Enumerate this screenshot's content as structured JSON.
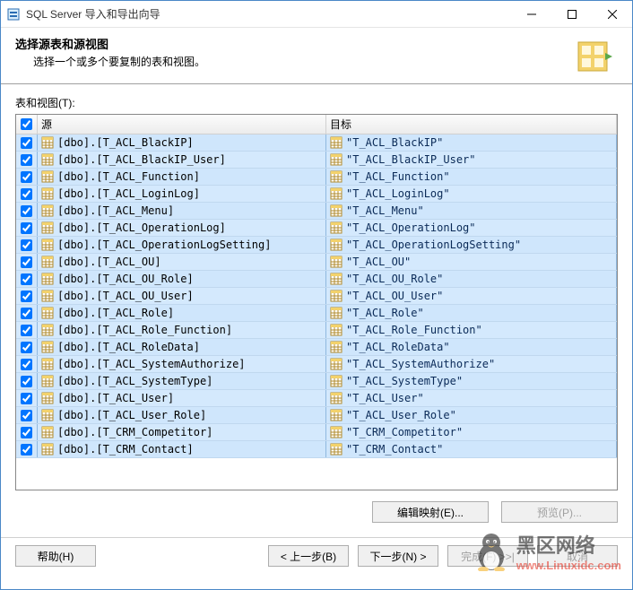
{
  "window": {
    "title": "SQL Server 导入和导出向导",
    "header_title": "选择源表和源视图",
    "header_sub": "选择一个或多个要复制的表和视图。"
  },
  "labels": {
    "tables_views": "表和视图(T):",
    "col_source": "源",
    "col_target": "目标",
    "edit_mapping": "编辑映射(E)...",
    "preview": "预览(P)...",
    "help": "帮助(H)",
    "back": "< 上一步(B)",
    "next": "下一步(N) >",
    "finish": "完成(F) >>|",
    "cancel": "取消"
  },
  "header_all_checked": true,
  "rows": [
    {
      "checked": true,
      "source": "[dbo].[T_ACL_BlackIP]",
      "target": "\"T_ACL_BlackIP\""
    },
    {
      "checked": true,
      "source": "[dbo].[T_ACL_BlackIP_User]",
      "target": "\"T_ACL_BlackIP_User\""
    },
    {
      "checked": true,
      "source": "[dbo].[T_ACL_Function]",
      "target": "\"T_ACL_Function\""
    },
    {
      "checked": true,
      "source": "[dbo].[T_ACL_LoginLog]",
      "target": "\"T_ACL_LoginLog\""
    },
    {
      "checked": true,
      "source": "[dbo].[T_ACL_Menu]",
      "target": "\"T_ACL_Menu\""
    },
    {
      "checked": true,
      "source": "[dbo].[T_ACL_OperationLog]",
      "target": "\"T_ACL_OperationLog\""
    },
    {
      "checked": true,
      "source": "[dbo].[T_ACL_OperationLogSetting]",
      "target": "\"T_ACL_OperationLogSetting\""
    },
    {
      "checked": true,
      "source": "[dbo].[T_ACL_OU]",
      "target": "\"T_ACL_OU\""
    },
    {
      "checked": true,
      "source": "[dbo].[T_ACL_OU_Role]",
      "target": "\"T_ACL_OU_Role\""
    },
    {
      "checked": true,
      "source": "[dbo].[T_ACL_OU_User]",
      "target": "\"T_ACL_OU_User\""
    },
    {
      "checked": true,
      "source": "[dbo].[T_ACL_Role]",
      "target": "\"T_ACL_Role\""
    },
    {
      "checked": true,
      "source": "[dbo].[T_ACL_Role_Function]",
      "target": "\"T_ACL_Role_Function\""
    },
    {
      "checked": true,
      "source": "[dbo].[T_ACL_RoleData]",
      "target": "\"T_ACL_RoleData\""
    },
    {
      "checked": true,
      "source": "[dbo].[T_ACL_SystemAuthorize]",
      "target": "\"T_ACL_SystemAuthorize\""
    },
    {
      "checked": true,
      "source": "[dbo].[T_ACL_SystemType]",
      "target": "\"T_ACL_SystemType\""
    },
    {
      "checked": true,
      "source": "[dbo].[T_ACL_User]",
      "target": "\"T_ACL_User\""
    },
    {
      "checked": true,
      "source": "[dbo].[T_ACL_User_Role]",
      "target": "\"T_ACL_User_Role\""
    },
    {
      "checked": true,
      "source": "[dbo].[T_CRM_Competitor]",
      "target": "\"T_CRM_Competitor\""
    },
    {
      "checked": true,
      "source": "[dbo].[T_CRM_Contact]",
      "target": "\"T_CRM_Contact\""
    }
  ],
  "watermark": {
    "main": "黑区网络",
    "sub": "www.Linuxidc.com"
  }
}
